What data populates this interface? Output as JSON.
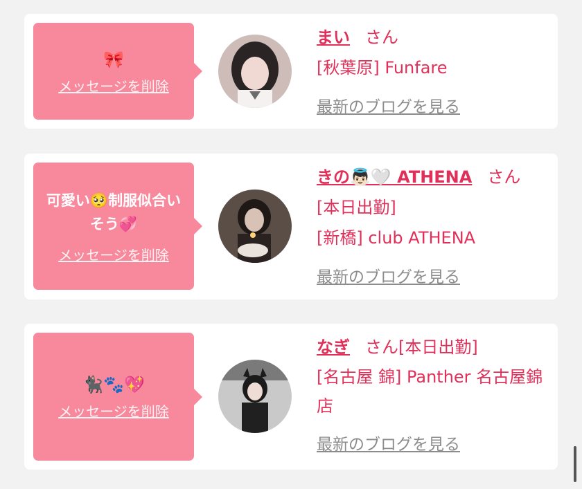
{
  "cards": [
    {
      "message": "🎀",
      "delete_label": "メッセージを削除",
      "name": "まい",
      "honorific": "さん",
      "status": "",
      "shop": "[秋葉原] Funfare",
      "blog_link": "最新のブログを見る"
    },
    {
      "message": "可愛い🥺制服似合いそう💞",
      "delete_label": "メッセージを削除",
      "name": "きの👼🏻🤍 ATHENA",
      "honorific": "さん",
      "status": "[本日出勤]",
      "shop": "[新橋] club ATHENA",
      "blog_link": "最新のブログを見る"
    },
    {
      "message": "🐈‍⬛🐾💖",
      "delete_label": "メッセージを削除",
      "name": "なぎ",
      "honorific": "さん",
      "status": "[本日出勤]",
      "shop": "[名古屋 錦] Panther 名古屋錦店",
      "blog_link": "最新のブログを見る"
    }
  ],
  "colors": {
    "accent": "#e0305a",
    "bubble": "#f8899c",
    "link_gray": "#8c8c8c"
  },
  "icons": {
    "avatar": "profile-photo"
  }
}
